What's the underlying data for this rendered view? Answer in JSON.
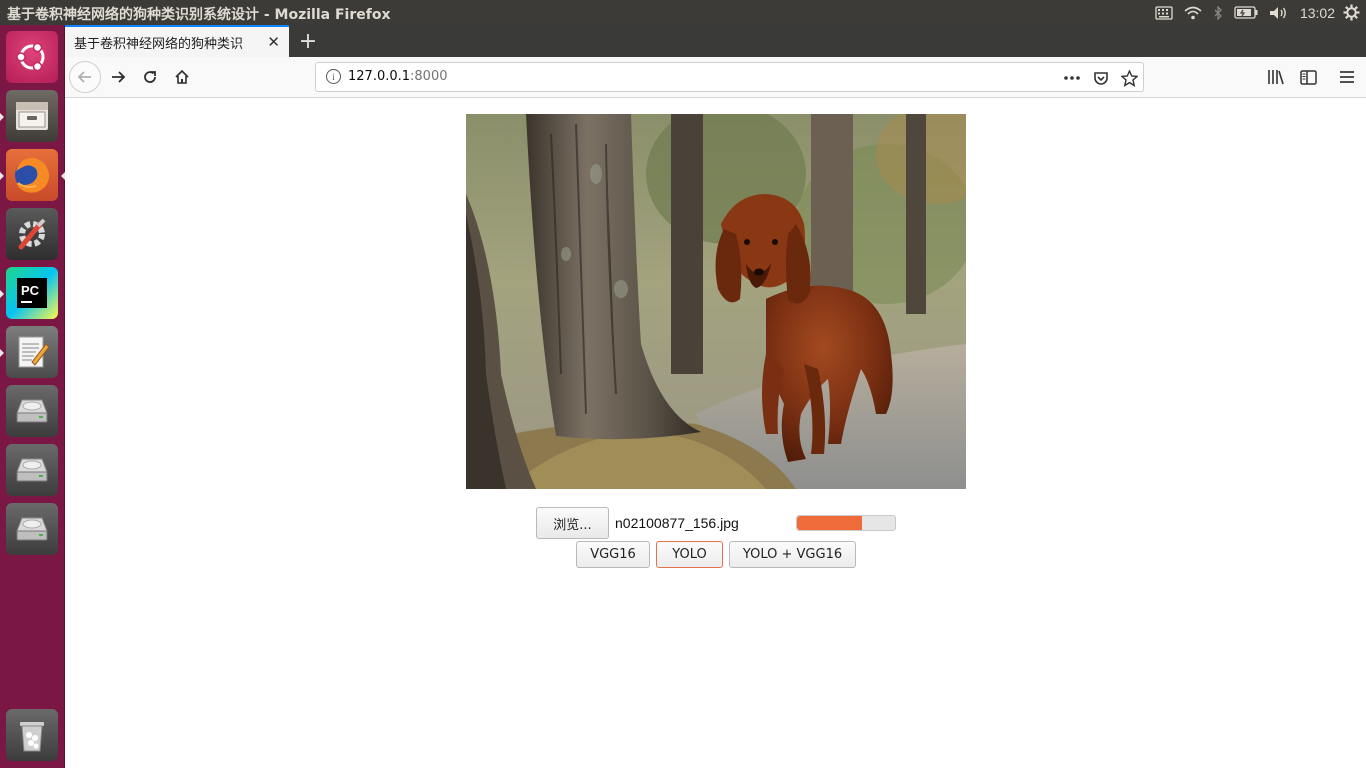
{
  "window": {
    "title": "基于卷积神经网络的狗种类识别系统设计 - Mozilla Firefox"
  },
  "system_tray": {
    "clock": "13:02",
    "icons": [
      "keyboard-icon",
      "wifi-icon",
      "bluetooth-icon",
      "battery-icon",
      "volume-icon",
      "settings-gear-icon"
    ]
  },
  "launcher": {
    "items": [
      "ubuntu-dash",
      "files",
      "firefox",
      "system-settings",
      "pycharm",
      "text-editor",
      "drive",
      "drive",
      "drive",
      "trash"
    ]
  },
  "tabs": [
    {
      "label": "基于卷积神经网络的狗种类识",
      "active": true
    }
  ],
  "url": {
    "host": "127.0.0.1",
    "port": ":8000"
  },
  "page": {
    "image_alt": "Irish setter dog walking on a path between trees",
    "browse_label": "浏览...",
    "file_name": "n02100877_156.jpg",
    "upload_progress": 0.66,
    "buttons": {
      "vgg16": "VGG16",
      "yolo": "YOLO",
      "yolo_vgg16": "YOLO + VGG16"
    }
  },
  "colors": {
    "launcher_bg": "#7a1745",
    "progress_fill": "#ef6b3a",
    "topbar_bg": "#3c3b37"
  }
}
